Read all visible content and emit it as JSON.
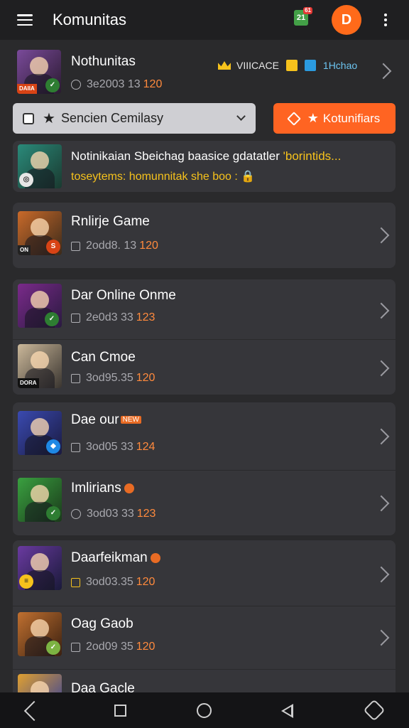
{
  "topbar": {
    "title": "Komunitas",
    "chat_badge": "61",
    "chat_icon_text": "21",
    "avatar_letter": "D"
  },
  "header_item": {
    "title": "Nothunitas",
    "meta": "3e2003 13",
    "meta_num": "120",
    "tag1": "VIIICACE",
    "tag2": "1Hchao",
    "thumb_label": "DAIIA"
  },
  "filter": {
    "dropdown_label": "Sencien Cemilasy",
    "button_label": "Kotunifiars"
  },
  "notification": {
    "line1_prefix": "Notinikaian Sbeichag baasice gdatatler ",
    "line1_highlight": "'borintids...",
    "line2": "toseytems: homunnitak she boo : "
  },
  "items": [
    {
      "title": "Rnlirje Game",
      "meta": "2odd8. 13",
      "num": "120",
      "icon": "calendar",
      "thumb_tag": "ON",
      "colors": [
        "#c96a2a",
        "#3b2a1a"
      ]
    },
    {
      "title": "Dar Online Onme",
      "meta": "2e0d3 33",
      "num": "123",
      "icon": "calendar",
      "thumb_tag": "",
      "colors": [
        "#7a2a8a",
        "#2a1a40"
      ]
    },
    {
      "title": "Can Cmoe",
      "meta": "3od95.35",
      "num": "120",
      "icon": "calendar",
      "thumb_tag": "DORA",
      "colors": [
        "#cbb89a",
        "#3a3530"
      ]
    },
    {
      "title": "Dae our",
      "meta": "3od05 33",
      "num": "124",
      "icon": "calendar",
      "thumb_tag": "",
      "colors": [
        "#3a4ab0",
        "#1a1a40"
      ]
    },
    {
      "title": "Imlirians",
      "meta": "3od03 33",
      "num": "123",
      "icon": "clock",
      "thumb_tag": "",
      "colors": [
        "#3aa040",
        "#1a3a1a"
      ]
    },
    {
      "title": "Daarfeikman",
      "meta": "3od03.35",
      "num": "120",
      "icon": "calendar-orange",
      "thumb_tag": "",
      "colors": [
        "#6a3aa0",
        "#1a1a3a"
      ]
    },
    {
      "title": "Oag Gaob",
      "meta": "2od09 35",
      "num": "120",
      "icon": "calendar",
      "thumb_tag": "",
      "colors": [
        "#c07030",
        "#3a2010"
      ]
    },
    {
      "title": "Daa Gacle",
      "meta": "",
      "num": "",
      "icon": "calendar",
      "thumb_tag": "",
      "colors": [
        "#e0a030",
        "#2a3aa0"
      ]
    }
  ],
  "new_tag": "NEW",
  "green_suffix": "Gaob"
}
